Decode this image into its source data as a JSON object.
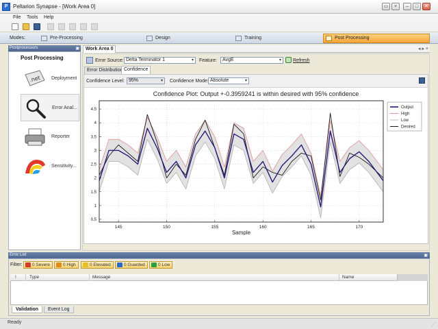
{
  "window": {
    "title": "Peltarion  Synapse - [Work Area 0]",
    "icon_letter": "P",
    "outer_buttons": [
      "–",
      "□",
      "✕"
    ]
  },
  "menu": [
    "File",
    "Tools",
    "Help"
  ],
  "modes": {
    "label": "Modes:",
    "items": [
      {
        "label": "Pre-Processing",
        "active": false
      },
      {
        "label": "Design",
        "active": false
      },
      {
        "label": "Training",
        "active": false
      },
      {
        "label": "Post Processing",
        "active": true
      }
    ]
  },
  "left_panel": {
    "header": "Postprocessors",
    "title": "Post Processing",
    "items": [
      {
        "label": "Deployment",
        "icon": "net-deployment-icon"
      },
      {
        "label": "Error Anal...",
        "icon": "magnifier-icon"
      },
      {
        "label": "Reporter",
        "icon": "printer-icon"
      },
      {
        "label": "Sensitivity...",
        "icon": "sensitivity-surface-icon"
      }
    ]
  },
  "work_area": {
    "tab": "Work Area 0",
    "error_source_label": "Error Source:",
    "error_source_value": "Delta Terminator 1",
    "feature_label": "Feature:",
    "feature_value": "AvgE",
    "refresh_label": "Refresh",
    "subtabs": [
      "Error Distribution",
      "Confidence"
    ],
    "confidence_level_label": "Confidence Level:",
    "confidence_level_value": "95%",
    "confidence_mode_label": "Confidence Mode:",
    "confidence_mode_value": "Absolute"
  },
  "chart_data": {
    "type": "line",
    "title": "Confidence Plot: Output +-0.3959241 is within desired with 95% confidence",
    "xlabel": "Sample",
    "ylabel": "",
    "xlim": [
      143,
      172.5
    ],
    "ylim": [
      0.4,
      4.8
    ],
    "x_ticks": [
      145,
      150,
      155,
      160,
      165,
      170
    ],
    "y_ticks": [
      0.5,
      1,
      1.5,
      2,
      2.5,
      3,
      3.5,
      4,
      4.5
    ],
    "legend_position": "top-right",
    "x": [
      143,
      144,
      145,
      146,
      147,
      148,
      149,
      150,
      151,
      152,
      153,
      154,
      155,
      156,
      157,
      158,
      159,
      160,
      161,
      162,
      163,
      164,
      165,
      166,
      167,
      168,
      169,
      170,
      171,
      172.5
    ],
    "series": [
      {
        "name": "Output",
        "color": "#2a1a7a",
        "values": [
          1.9,
          3.0,
          3.0,
          2.8,
          2.5,
          3.8,
          3.1,
          2.2,
          2.6,
          2.0,
          3.2,
          3.7,
          3.1,
          2.0,
          3.6,
          3.4,
          2.2,
          2.6,
          1.85,
          2.45,
          2.8,
          3.2,
          2.5,
          0.95,
          3.7,
          2.2,
          2.7,
          2.95,
          2.6,
          1.9
        ]
      },
      {
        "name": "High",
        "color": "#e09a9a",
        "values": [
          2.3,
          3.4,
          3.4,
          3.2,
          2.9,
          4.2,
          3.5,
          2.6,
          3.0,
          2.4,
          3.6,
          4.1,
          3.5,
          2.4,
          4.0,
          3.8,
          2.6,
          3.0,
          2.25,
          2.85,
          3.2,
          3.6,
          2.9,
          1.35,
          4.1,
          2.6,
          3.1,
          3.35,
          3.0,
          2.3
        ]
      },
      {
        "name": "Low",
        "color": "#b5b5b5",
        "values": [
          1.5,
          2.6,
          2.6,
          2.4,
          2.1,
          3.4,
          2.7,
          1.8,
          2.2,
          1.6,
          2.8,
          3.3,
          2.7,
          1.6,
          3.2,
          3.0,
          1.8,
          2.2,
          1.45,
          2.05,
          2.4,
          2.8,
          2.1,
          0.55,
          3.3,
          1.8,
          2.3,
          2.55,
          2.2,
          1.5
        ]
      },
      {
        "name": "Desired",
        "color": "#1a1a1a",
        "values": [
          2.1,
          2.8,
          3.2,
          2.9,
          2.6,
          4.3,
          3.3,
          2.0,
          2.5,
          2.1,
          3.4,
          4.1,
          3.1,
          2.1,
          3.95,
          3.6,
          2.0,
          2.4,
          2.2,
          2.1,
          2.6,
          2.9,
          2.8,
          1.2,
          4.35,
          2.05,
          2.9,
          2.75,
          2.5,
          2.0
        ]
      }
    ]
  },
  "error_list": {
    "header": "Error List",
    "filter_label": "Filter:",
    "filters": [
      {
        "label": "0 Severe",
        "color": "#d63a2a"
      },
      {
        "label": "0 High",
        "color": "#e08a1a"
      },
      {
        "label": "0 Elevated",
        "color": "#e8c020"
      },
      {
        "label": "0 Guarded",
        "color": "#2a6ad0"
      },
      {
        "label": "0 Low",
        "color": "#2aa040"
      }
    ],
    "columns": [
      "!",
      "Type",
      "Message",
      "Name"
    ],
    "tabs": [
      "Validation",
      "Event Log"
    ]
  },
  "status": "Ready"
}
